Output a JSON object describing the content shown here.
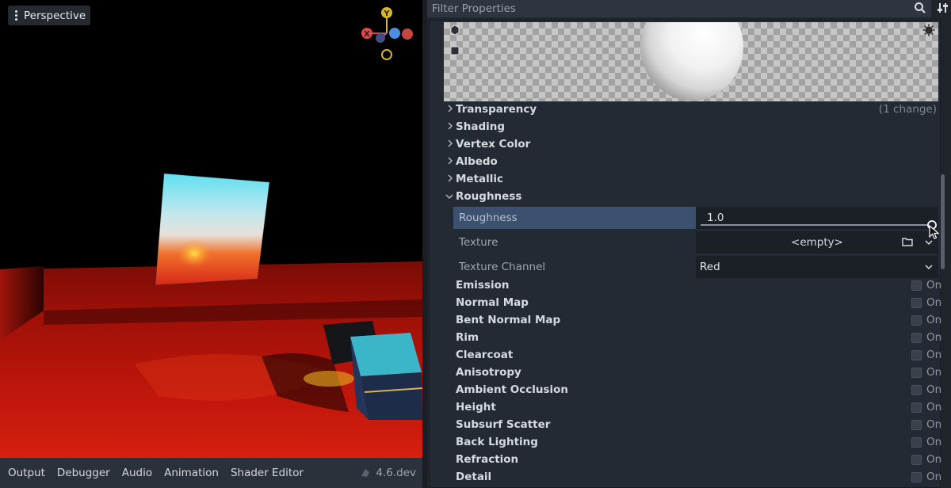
{
  "viewport": {
    "view_mode": "Perspective",
    "gizmo": {
      "y_axis": "Y",
      "x_axis": "X",
      "colors": {
        "x": "#e04848",
        "y": "#d9b52c",
        "z": "#4a8fe0"
      }
    }
  },
  "bottom_bar": {
    "tabs": [
      "Output",
      "Debugger",
      "Audio",
      "Animation",
      "Shader Editor"
    ],
    "version": "4.6.dev"
  },
  "inspector": {
    "filter_placeholder": "Filter Properties",
    "sections_top": [
      {
        "label": "Transparency",
        "note": "(1 change)"
      },
      {
        "label": "Shading"
      },
      {
        "label": "Vertex Color"
      },
      {
        "label": "Albedo"
      },
      {
        "label": "Metallic"
      }
    ],
    "roughness_section": {
      "label": "Roughness",
      "expanded": true,
      "properties": {
        "roughness": {
          "label": "Roughness",
          "value": "1.0",
          "fraction": 1.0
        },
        "texture": {
          "label": "Texture",
          "value": "<empty>"
        },
        "texture_channel": {
          "label": "Texture Channel",
          "value": "Red"
        }
      }
    },
    "toggle_sections": [
      "Emission",
      "Normal Map",
      "Bent Normal Map",
      "Rim",
      "Clearcoat",
      "Anisotropy",
      "Ambient Occlusion",
      "Height",
      "Subsurf Scatter",
      "Back Lighting",
      "Refraction",
      "Detail"
    ],
    "toggle_label": "On"
  },
  "colors": {
    "accent": "#3c5170",
    "panel_bg": "#242a33",
    "viewport_floor": "#b5120b"
  }
}
